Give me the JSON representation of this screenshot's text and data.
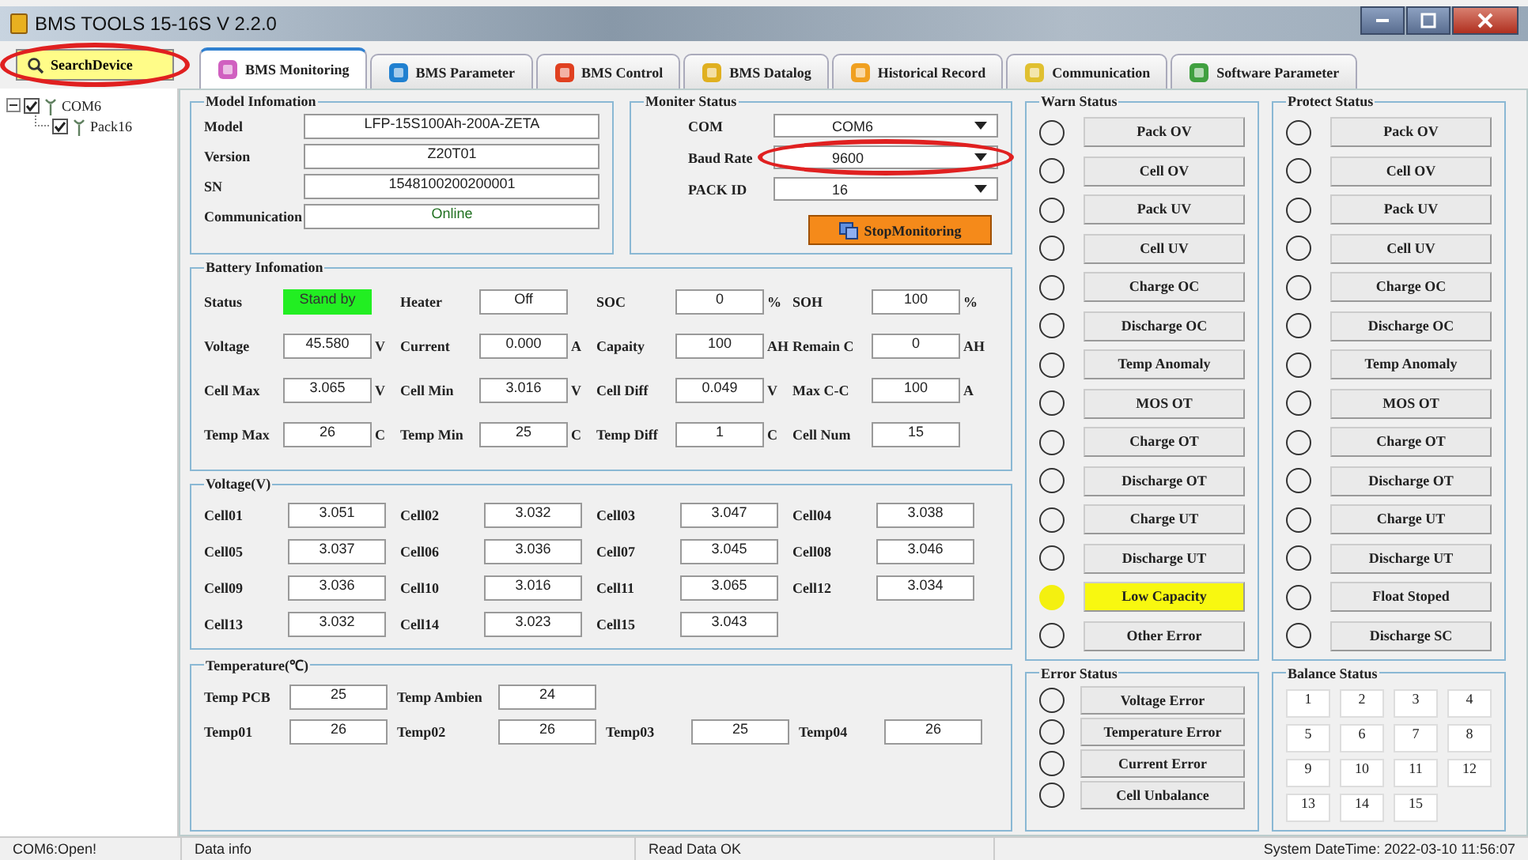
{
  "window": {
    "title": "BMS TOOLS 15-16S V 2.2.0"
  },
  "search_button": {
    "label": "SearchDevice",
    "circled": true
  },
  "tabs": [
    {
      "label": "BMS Monitoring",
      "selected": true
    },
    {
      "label": "BMS Parameter",
      "selected": false
    },
    {
      "label": "BMS Control",
      "selected": false
    },
    {
      "label": "BMS Datalog",
      "selected": false
    },
    {
      "label": "Historical Record",
      "selected": false
    },
    {
      "label": "Communication",
      "selected": false
    },
    {
      "label": "Software Parameter",
      "selected": false
    }
  ],
  "tree": [
    {
      "label": "COM6",
      "checked": true,
      "expanded": true,
      "children": [
        {
          "label": "Pack16",
          "checked": true
        }
      ]
    }
  ],
  "model_info": {
    "title": "Model Infomation",
    "fields": [
      {
        "label": "Model",
        "value": "LFP-15S100Ah-200A-ZETA",
        "kind": "text"
      },
      {
        "label": "Version",
        "value": "Z20T01",
        "kind": "text"
      },
      {
        "label": "SN",
        "value": "1548100200200001",
        "kind": "text"
      },
      {
        "label": "Communication",
        "value": "Online",
        "kind": "status"
      }
    ]
  },
  "monitor_status": {
    "title": "Moniter Status",
    "fields": [
      {
        "label": "COM",
        "value": "COM6"
      },
      {
        "label": "Baud Rate",
        "value": "9600",
        "circled": true
      },
      {
        "label": "PACK ID",
        "value": "16"
      }
    ],
    "button": "StopMonitoring"
  },
  "battery_info": {
    "title": "Battery Infomation",
    "fields": [
      {
        "label": "Status",
        "value": "Stand by",
        "kind": "status"
      },
      {
        "label": "Heater",
        "value": "Off",
        "kind": "text"
      },
      {
        "label": "SOC",
        "value": "0",
        "unit": "%",
        "kind": "text"
      },
      {
        "label": "SOH",
        "value": "100",
        "unit": "%",
        "kind": "text"
      },
      {
        "label": "Voltage",
        "value": "45.580",
        "unit": "V",
        "kind": "text"
      },
      {
        "label": "Current",
        "value": "0.000",
        "unit": "A",
        "kind": "text"
      },
      {
        "label": "Capaity",
        "value": "100",
        "unit": "AH",
        "kind": "text"
      },
      {
        "label": "Remain C",
        "value": "0",
        "unit": "AH",
        "kind": "text"
      },
      {
        "label": "Cell Max",
        "value": "3.065",
        "unit": "V",
        "kind": "text"
      },
      {
        "label": "Cell Min",
        "value": "3.016",
        "unit": "V",
        "kind": "text"
      },
      {
        "label": "Cell Diff",
        "value": "0.049",
        "unit": "V",
        "kind": "text"
      },
      {
        "label": "Max C-C",
        "value": "100",
        "unit": "A",
        "kind": "text"
      },
      {
        "label": "Temp Max",
        "value": "26",
        "unit": "C",
        "kind": "text"
      },
      {
        "label": "Temp Min",
        "value": "25",
        "unit": "C",
        "kind": "text"
      },
      {
        "label": "Temp Diff",
        "value": "1",
        "unit": "C",
        "kind": "text"
      },
      {
        "label": "Cell Num",
        "value": "15",
        "kind": "text"
      }
    ]
  },
  "voltage": {
    "title": "Voltage(V)",
    "cells": [
      {
        "label": "Cell01",
        "value": "3.051"
      },
      {
        "label": "Cell02",
        "value": "3.032"
      },
      {
        "label": "Cell03",
        "value": "3.047"
      },
      {
        "label": "Cell04",
        "value": "3.038"
      },
      {
        "label": "Cell05",
        "value": "3.037"
      },
      {
        "label": "Cell06",
        "value": "3.036"
      },
      {
        "label": "Cell07",
        "value": "3.045"
      },
      {
        "label": "Cell08",
        "value": "3.046"
      },
      {
        "label": "Cell09",
        "value": "3.036"
      },
      {
        "label": "Cell10",
        "value": "3.016"
      },
      {
        "label": "Cell11",
        "value": "3.065"
      },
      {
        "label": "Cell12",
        "value": "3.034"
      },
      {
        "label": "Cell13",
        "value": "3.032"
      },
      {
        "label": "Cell14",
        "value": "3.023"
      },
      {
        "label": "Cell15",
        "value": "3.043"
      }
    ]
  },
  "temperature": {
    "title": "Temperature(℃)",
    "rows": [
      [
        {
          "label": "Temp PCB",
          "value": "25"
        },
        {
          "label": "Temp Ambien",
          "value": "24"
        }
      ],
      [
        {
          "label": "Temp01",
          "value": "26"
        },
        {
          "label": "Temp02",
          "value": "26"
        },
        {
          "label": "Temp03",
          "value": "25"
        },
        {
          "label": "Temp04",
          "value": "26"
        }
      ]
    ]
  },
  "warn_status": {
    "title": "Warn Status",
    "items": [
      {
        "label": "Pack OV",
        "active": false
      },
      {
        "label": "Cell OV",
        "active": false
      },
      {
        "label": "Pack UV",
        "active": false
      },
      {
        "label": "Cell UV",
        "active": false
      },
      {
        "label": "Charge OC",
        "active": false
      },
      {
        "label": "Discharge OC",
        "active": false
      },
      {
        "label": "Temp Anomaly",
        "active": false
      },
      {
        "label": "MOS OT",
        "active": false
      },
      {
        "label": "Charge OT",
        "active": false
      },
      {
        "label": "Discharge OT",
        "active": false
      },
      {
        "label": "Charge UT",
        "active": false
      },
      {
        "label": "Discharge UT",
        "active": false
      },
      {
        "label": "Low Capacity",
        "active": true
      },
      {
        "label": "Other Error",
        "active": false
      }
    ]
  },
  "protect_status": {
    "title": "Protect Status",
    "items": [
      {
        "label": "Pack OV",
        "active": false
      },
      {
        "label": "Cell OV",
        "active": false
      },
      {
        "label": "Pack UV",
        "active": false
      },
      {
        "label": "Cell UV",
        "active": false
      },
      {
        "label": "Charge OC",
        "active": false
      },
      {
        "label": "Discharge OC",
        "active": false
      },
      {
        "label": "Temp Anomaly",
        "active": false
      },
      {
        "label": "MOS OT",
        "active": false
      },
      {
        "label": "Charge OT",
        "active": false
      },
      {
        "label": "Discharge OT",
        "active": false
      },
      {
        "label": "Charge UT",
        "active": false
      },
      {
        "label": "Discharge UT",
        "active": false
      },
      {
        "label": "Float Stoped",
        "active": false
      },
      {
        "label": "Discharge SC",
        "active": false
      }
    ]
  },
  "error_status": {
    "title": "Error Status",
    "items": [
      {
        "label": "Voltage Error",
        "active": false
      },
      {
        "label": "Temperature Error",
        "active": false
      },
      {
        "label": "Current Error",
        "active": false
      },
      {
        "label": "Cell Unbalance",
        "active": false
      }
    ]
  },
  "balance_status": {
    "title": "Balance Status",
    "cells": [
      "1",
      "2",
      "3",
      "4",
      "5",
      "6",
      "7",
      "8",
      "9",
      "10",
      "11",
      "12",
      "13",
      "14",
      "15"
    ]
  },
  "status_bar": [
    "COM6:Open!",
    "Data info",
    "Read Data OK",
    "System DateTime: 2022-03-10 11:56:07"
  ]
}
